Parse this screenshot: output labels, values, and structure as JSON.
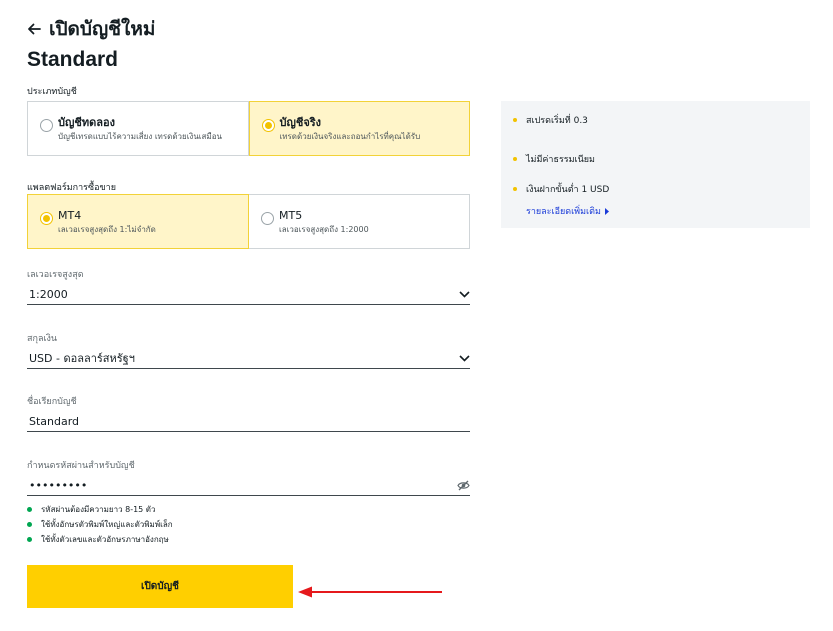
{
  "header": {
    "title": "เปิดบัญชีใหม่",
    "account_name": "Standard"
  },
  "account_type": {
    "label": "ประเภทบัญชี",
    "options": [
      {
        "title": "บัญชีทดลอง",
        "desc": "บัญชีเทรดแบบไร้ความเสี่ยง เทรดด้วยเงินเสมือน",
        "selected": false
      },
      {
        "title": "บัญชีจริง",
        "desc": "เทรดด้วยเงินจริงและถอนกำไรที่คุณได้รับ",
        "selected": true
      }
    ]
  },
  "platform": {
    "label": "แพลตฟอร์มการซื้อขาย",
    "options": [
      {
        "title": "MT4",
        "desc": "เลเวอเรจสูงสุดถึง 1:ไม่จำกัด",
        "selected": true
      },
      {
        "title": "MT5",
        "desc": "เลเวอเรจสูงสุดถึง 1:2000",
        "selected": false
      }
    ]
  },
  "leverage": {
    "label": "เลเวอเรจสูงสุด",
    "value": "1:2000"
  },
  "currency": {
    "label": "สกุลเงิน",
    "value": "USD - ดอลลาร์สหรัฐฯ"
  },
  "nickname": {
    "label": "ชื่อเรียกบัญชี",
    "value": "Standard"
  },
  "password": {
    "label": "กำหนดรหัสผ่านสำหรับบัญชี",
    "value": "•••••••••",
    "rules": [
      "รหัสผ่านต้องมีความยาว 8-15 ตัว",
      "ใช้ทั้งอักษรตัวพิมพ์ใหญ่และตัวพิมพ์เล็ก",
      "ใช้ทั้งตัวเลขและตัวอักษรภาษาอังกฤษ"
    ]
  },
  "submit_label": "เปิดบัญชี",
  "info": {
    "items": [
      "สเปรดเริ่มที่ 0.3",
      "ไม่มีค่าธรรมเนียม",
      "เงินฝากขั้นต่ำ 1 USD"
    ],
    "link": "รายละเอียดเพิ่มเติม"
  },
  "colors": {
    "accent": "#ffcf00",
    "selected_bg": "#fff5c9",
    "rule_ok": "#00a651",
    "link": "#1a3bd8",
    "annotation_arrow": "#e5191c"
  }
}
